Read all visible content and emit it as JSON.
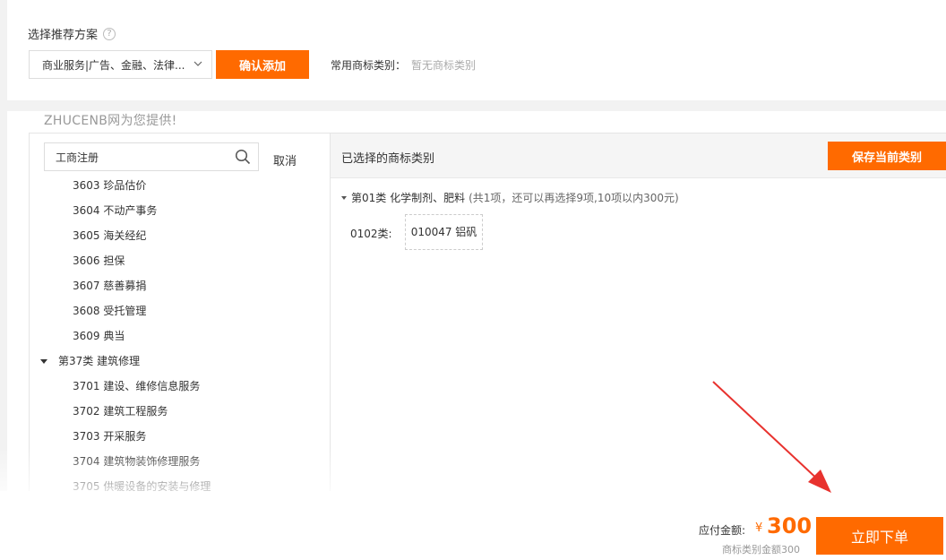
{
  "scheme": {
    "title": "选择推荐方案",
    "help_glyph": "?",
    "select_value": "商业服务|广告、金融、法律...",
    "confirm_label": "确认添加",
    "common_label": "常用商标类别：",
    "common_value": "暂无商标类别"
  },
  "provider_note": "ZHUCENB网为您提供!",
  "search": {
    "value": "工商注册",
    "cancel_label": "取消"
  },
  "tree": {
    "items": [
      {
        "label": "3603 珍品估价"
      },
      {
        "label": "3604 不动产事务"
      },
      {
        "label": "3605 海关经纪"
      },
      {
        "label": "3606 担保"
      },
      {
        "label": "3607 慈善募捐"
      },
      {
        "label": "3608 受托管理"
      },
      {
        "label": "3609 典当"
      },
      {
        "label": "第37类 建筑修理"
      },
      {
        "label": "3701 建设、维修信息服务"
      },
      {
        "label": "3702 建筑工程服务"
      },
      {
        "label": "3703 开采服务"
      },
      {
        "label": "3704 建筑物装饰修理服务"
      },
      {
        "label": "3705 供暖设备的安装与修理"
      }
    ]
  },
  "selected": {
    "title": "已选择的商标类别",
    "save_label": "保存当前类别",
    "class_name": "第01类 化学制剂、肥料",
    "class_meta": "(共1项，还可以再选择9项,10项以内300元)",
    "group_label": "0102类:",
    "item_label": "010047 铝矾"
  },
  "payment": {
    "label": "应付金额:",
    "currency": "¥",
    "amount": "300",
    "sub": "商标类别金额300",
    "order_label": "立即下单"
  },
  "colors": {
    "accent": "#ff6a00",
    "arrow": "#e8322e"
  },
  "icons": [
    "help-icon",
    "chevron-down-icon",
    "search-icon",
    "caret-down-icon",
    "arrow-annotation"
  ]
}
